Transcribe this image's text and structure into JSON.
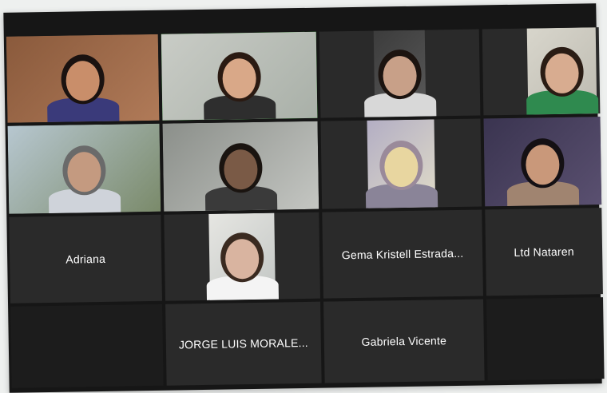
{
  "meeting": {
    "participants": [
      {
        "id": "p1",
        "name": "",
        "video": true,
        "bg": "#8a5a3c",
        "bg2": "#b07a58",
        "skin": "#c98e6a",
        "hair": "#1a1210",
        "shirt": "#3a3a7a"
      },
      {
        "id": "p2",
        "name": "",
        "video": true,
        "speaking": true,
        "bg": "#c9ccc6",
        "bg2": "#a9b0a8",
        "skin": "#d9a888",
        "hair": "#2a1a12",
        "shirt": "#2e2e2e"
      },
      {
        "id": "p3",
        "name": "",
        "video": true,
        "bg": "#3c3c3c",
        "bg2": "#5a5a5a",
        "skin": "#c8a088",
        "hair": "#1c1410",
        "shirt": "#d8d8d8"
      },
      {
        "id": "p4",
        "name": "",
        "video": true,
        "bg": "#d8d6cc",
        "bg2": "#bdbab0",
        "skin": "#d8ac90",
        "hair": "#2a1c14",
        "shirt": "#2f8a4f"
      },
      {
        "id": "p5",
        "name": "",
        "video": true,
        "bg": "#b7c7d0",
        "bg2": "#7a8a6a",
        "skin": "#c49a80",
        "hair": "#6a6a6a",
        "shirt": "#cfd3da"
      },
      {
        "id": "p6",
        "name": "",
        "video": true,
        "bg": "#8b8f8a",
        "bg2": "#c4c6c2",
        "skin": "#7a5a46",
        "hair": "#1a1410",
        "shirt": "#3a3a3a"
      },
      {
        "id": "p7",
        "name": "",
        "video": true,
        "bg": "#b3aec4",
        "bg2": "#e0dcc8",
        "skin": "#e8d6a0",
        "hair": "#9a8a9a",
        "shirt": "#8a8498"
      },
      {
        "id": "p8",
        "name": "",
        "video": true,
        "bg": "#3a3450",
        "bg2": "#5a5070",
        "skin": "#c9987a",
        "hair": "#141014",
        "shirt": "#a08470"
      },
      {
        "id": "p9",
        "name": "Adriana",
        "video": false
      },
      {
        "id": "p10",
        "name": "",
        "video": true,
        "bg": "#e6e6e2",
        "bg2": "#c2c6c4",
        "skin": "#d9b4a0",
        "hair": "#3a2a20",
        "shirt": "#f4f4f4"
      },
      {
        "id": "p11",
        "name": "Gema Kristell Estrada...",
        "video": false
      },
      {
        "id": "p12",
        "name": "Ltd Nataren",
        "video": false
      },
      {
        "id": "p13",
        "name": "",
        "video": false,
        "empty": true
      },
      {
        "id": "p14",
        "name": "JORGE LUIS MORALE...",
        "video": false
      },
      {
        "id": "p15",
        "name": "Gabriela Vicente",
        "video": false
      },
      {
        "id": "p16",
        "name": "",
        "video": false,
        "empty": true
      }
    ]
  },
  "colors": {
    "tile_bg": "#2a2a2a",
    "speaking_border": "#3fbf3f",
    "frame_bg": "#161616",
    "name_text": "#ffffff"
  }
}
